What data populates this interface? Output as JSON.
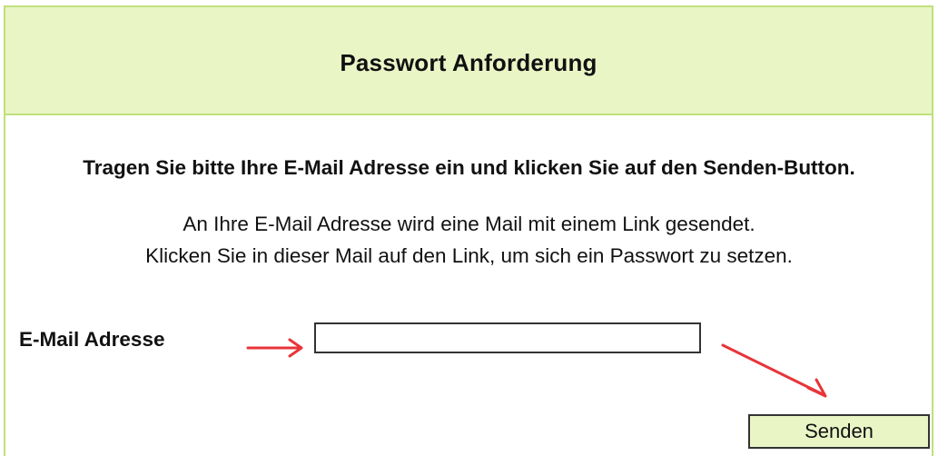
{
  "header": {
    "title": "Passwort Anforderung"
  },
  "instructions": {
    "bold_text": "Tragen Sie bitte Ihre E-Mail Adresse ein und klicken Sie auf den Senden-Button.",
    "line_1": "An Ihre E-Mail Adresse wird eine Mail mit einem Link gesendet.",
    "line_2": "Klicken Sie in dieser Mail auf den Link, um sich ein Passwort zu setzen."
  },
  "form": {
    "email_label": "E-Mail Adresse",
    "email_value": "",
    "email_placeholder": "",
    "submit_label": "Senden"
  },
  "annotations": {
    "arrow_color": "#e8343a",
    "arrow_icon": "red-arrow-annotation"
  },
  "colors": {
    "header_background": "#eaf5c6",
    "border": "#bfe07a",
    "button_background": "#eaf5c6"
  }
}
